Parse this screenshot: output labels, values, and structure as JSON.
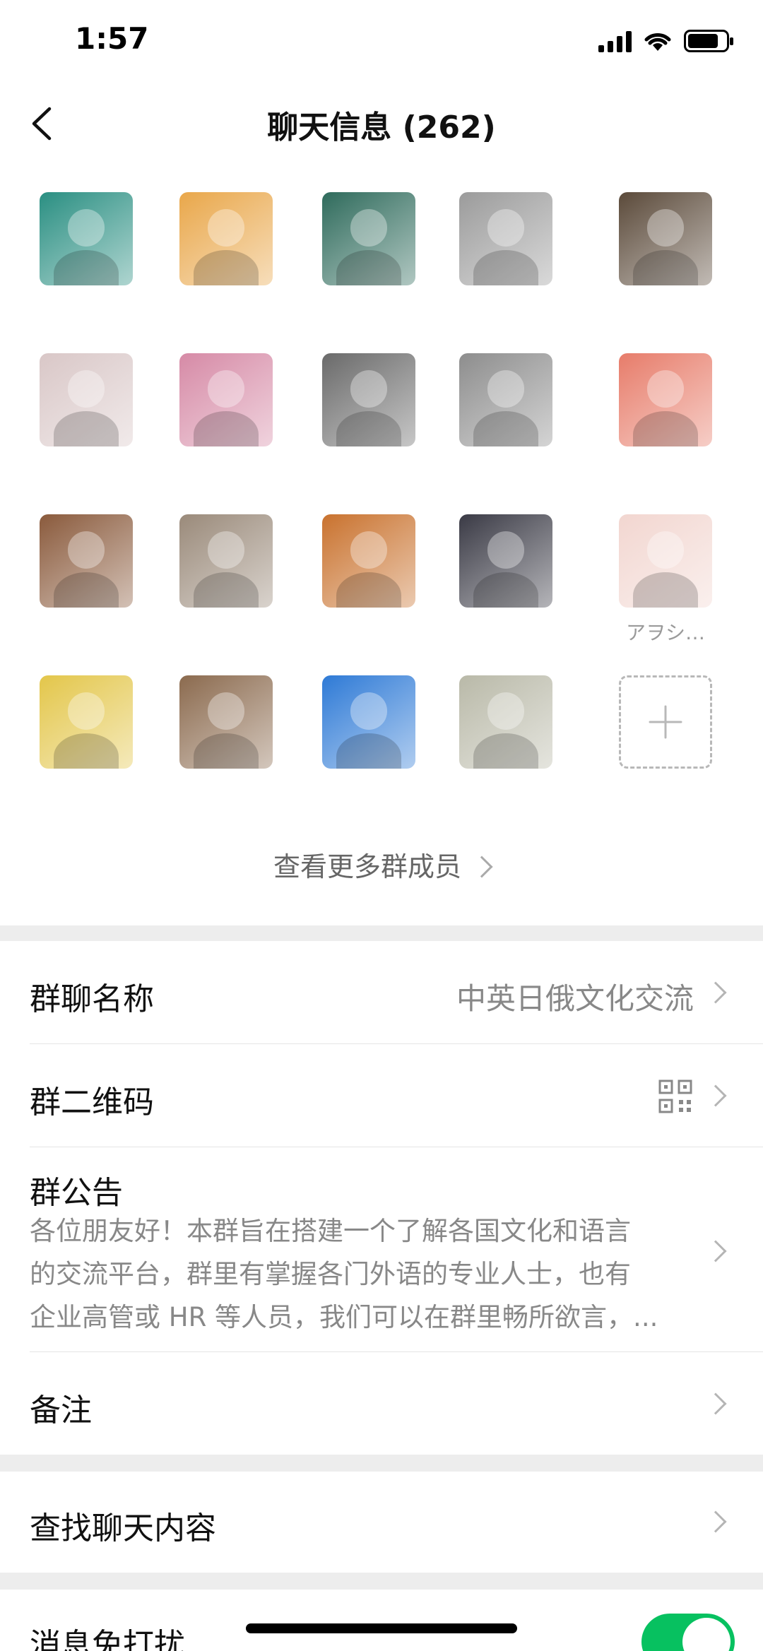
{
  "status_bar": {
    "time": "1:57"
  },
  "nav": {
    "title": "聊天信息 (262)"
  },
  "members": [
    {
      "name": "",
      "avatar": "person-teal-jacket",
      "color": "#2a8f82"
    },
    {
      "name": "",
      "avatar": "bear-cartoon",
      "color": "#e9a74a"
    },
    {
      "name": "",
      "avatar": "night-street",
      "color": "#2f6b5c"
    },
    {
      "name": "",
      "avatar": "blurred-gray",
      "color": "#9b9b9b"
    },
    {
      "name": "",
      "avatar": "window-house",
      "color": "#5b4a3a"
    },
    {
      "name": "",
      "avatar": "white-rabbit",
      "color": "#d9c7c7"
    },
    {
      "name": "",
      "avatar": "pink-jacket-girl",
      "color": "#d68aa6"
    },
    {
      "name": "",
      "avatar": "dark-girl",
      "color": "#6a6a6a"
    },
    {
      "name": "",
      "avatar": "girl-hands",
      "color": "#8d8d8d"
    },
    {
      "name": "",
      "avatar": "panda-cartoon",
      "color": "#e77c6a"
    },
    {
      "name": "",
      "avatar": "brown-swirl",
      "color": "#8a5a3c"
    },
    {
      "name": "",
      "avatar": "gray-swirl",
      "color": "#9a8a7a"
    },
    {
      "name": "",
      "avatar": "orange-swirl",
      "color": "#c9722e"
    },
    {
      "name": "",
      "avatar": "red-car",
      "color": "#3a3a45"
    },
    {
      "name": "アヲシ…",
      "avatar": "anime-girl",
      "color": "#f2d6d0"
    },
    {
      "name": "",
      "avatar": "blonde-anime",
      "color": "#e3c64a"
    },
    {
      "name": "",
      "avatar": "shark-mouth",
      "color": "#8b6a4e"
    },
    {
      "name": "",
      "avatar": "blue-sky-cloud",
      "color": "#2e7ad6"
    },
    {
      "name": "",
      "avatar": "anime-boy",
      "color": "#b9b9a8"
    }
  ],
  "more_members_label": "查看更多群成员",
  "settings": {
    "group_name": {
      "label": "群聊名称",
      "value": "中英日俄文化交流"
    },
    "qr_code": {
      "label": "群二维码"
    },
    "announcement": {
      "label": "群公告",
      "line1": "各位朋友好！本群旨在搭建一个了解各国文化和语言",
      "line2": "的交流平台，群里有掌握各门外语的专业人士，也有",
      "line3": "企业高管或 HR 等人员，我们可以在群里畅所欲言，..."
    },
    "remark": {
      "label": "备注"
    },
    "search_chat": {
      "label": "查找聊天内容"
    },
    "do_not_disturb": {
      "label": "消息免打扰",
      "on": true
    }
  },
  "colors": {
    "accent": "#07c160",
    "background": "#ededed"
  }
}
